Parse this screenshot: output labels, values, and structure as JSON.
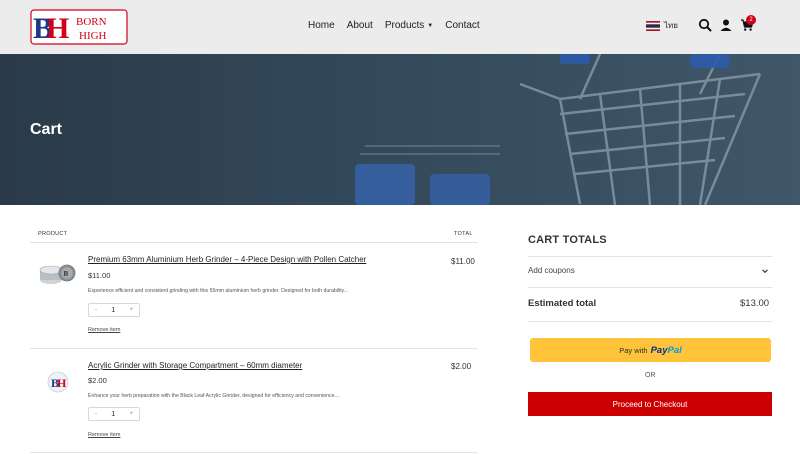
{
  "header": {
    "logo_text_top": "BORN",
    "logo_text_bottom": "HIGH",
    "nav": [
      "Home",
      "About",
      "Products",
      "Contact"
    ],
    "language": "ไทย",
    "cart_count": "2",
    "colors": {
      "brand_red": "#d0021b",
      "brand_blue": "#1d3a8a"
    }
  },
  "hero": {
    "title": "Cart"
  },
  "table": {
    "col_product": "PRODUCT",
    "col_total": "TOTAL",
    "items": [
      {
        "title": "Premium 63mm Aluminium Herb Grinder – 4-Piece Design with Pollen Catcher",
        "price": "$11.00",
        "description": "Experience efficient and consistent grinding with this 55mm aluminium herb grinder. Designed for both durability...",
        "qty": "1",
        "total": "$11.00",
        "remove": "Remove item"
      },
      {
        "title": "Acrylic Grinder with Storage Compartment – 60mm diameter",
        "price": "$2.00",
        "description": "Enhance your herb preparation with the Black Leaf Acrylic Grinder, designed for efficiency and convenience....",
        "qty": "1",
        "total": "$2.00",
        "remove": "Remove item"
      }
    ],
    "stepper_minus": "-",
    "stepper_plus": "+"
  },
  "totals": {
    "title": "CART TOTALS",
    "coupons": "Add coupons",
    "estimated_label": "Estimated total",
    "estimated_value": "$13.00",
    "paypal_prefix": "Pay with",
    "paypal_brand_a": "Pay",
    "paypal_brand_b": "Pal",
    "or": "OR",
    "checkout": "Proceed to Checkout",
    "colors": {
      "paypal": "#ffc439",
      "checkout": "#cc0000"
    }
  }
}
